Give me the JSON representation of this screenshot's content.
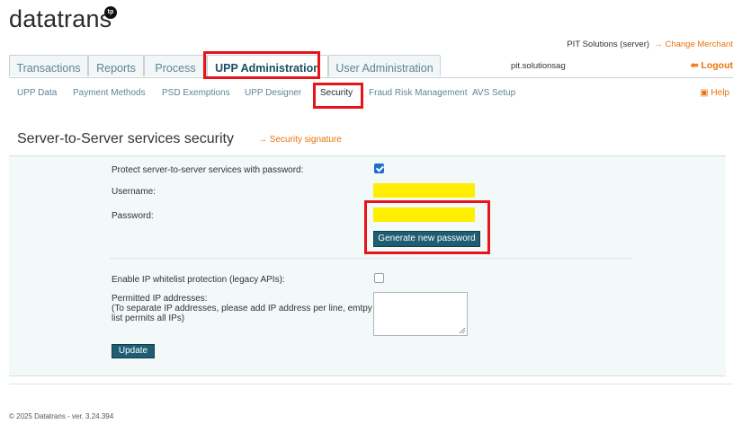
{
  "logo": {
    "text": "datatrans",
    "badge": "tp"
  },
  "header": {
    "merchant": "PIT Solutions (server)",
    "change_merchant": "→  Change Merchant",
    "user_login": "pit.solutionsag",
    "logout": "⇚ Logout"
  },
  "tabs": [
    {
      "label": "Transactions"
    },
    {
      "label": "Reports"
    },
    {
      "label": "Process"
    },
    {
      "label": "UPP Administration",
      "active": true
    },
    {
      "label": "User Administration"
    }
  ],
  "subnav": [
    {
      "label": "UPP Data"
    },
    {
      "label": "Payment Methods"
    },
    {
      "label": "PSD Exemptions"
    },
    {
      "label": "UPP Designer"
    },
    {
      "label": "Security",
      "active": true
    },
    {
      "label": "Fraud Risk Management"
    },
    {
      "label": "AVS Setup"
    }
  ],
  "help": "▣ Help",
  "page": {
    "title": "Server-to-Server services security",
    "security_signature": "→  Security signature"
  },
  "form": {
    "protect_label": "Protect server-to-server services with password:",
    "protect_checked": true,
    "username_label": "Username:",
    "username_value": "",
    "password_label": "Password:",
    "password_value": "",
    "generate_button": "Generate new password",
    "ip_whitelist_label": "Enable IP whitelist protection (legacy APIs):",
    "ip_whitelist_checked": false,
    "permitted_label": "Permitted IP addresses:",
    "permitted_hint": "(To separate IP addresses, please add IP address per line, emtpy list permits all IPs)",
    "permitted_value": "",
    "update_button": "Update"
  },
  "footer": "© 2025 Datatrans - ver. 3.24.394",
  "colors": {
    "accent": "#e8730c",
    "tab_text": "#5d8597",
    "button": "#1f5d72",
    "highlight": "#e8141a",
    "masked_field": "#ffee00"
  }
}
